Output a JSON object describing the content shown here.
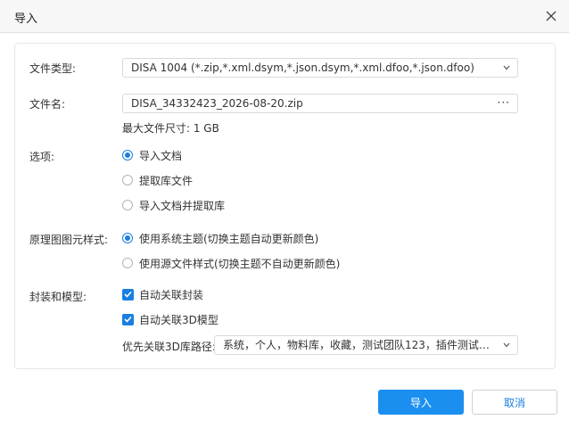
{
  "window": {
    "title": "导入"
  },
  "form": {
    "file_type": {
      "label": "文件类型:",
      "value": "DISA 1004 (*.zip,*.xml.dsym,*.json.dsym,*.xml.dfoo,*.json.dfoo)"
    },
    "file_name": {
      "label": "文件名:",
      "value": "DISA_34332423_2026-08-20.zip",
      "browse": "···"
    },
    "max_size": "最大文件尺寸: 1 GB",
    "options": {
      "label": "选项:",
      "items": [
        {
          "label": "导入文档",
          "selected": true
        },
        {
          "label": "提取库文件",
          "selected": false
        },
        {
          "label": "导入文档并提取库",
          "selected": false
        }
      ]
    },
    "style": {
      "label": "原理图图元样式:",
      "items": [
        {
          "label": "使用系统主题(切换主题自动更新颜色)",
          "selected": true
        },
        {
          "label": "使用源文件样式(切换主题不自动更新颜色)",
          "selected": false
        }
      ]
    },
    "package": {
      "label": "封装和模型:",
      "items": [
        {
          "label": "自动关联封装",
          "checked": true
        },
        {
          "label": "自动关联3D模型",
          "checked": true
        }
      ],
      "path_label": "优先关联3D库路径:",
      "path_value": "系统，个人，物料库，收藏，测试团队123，插件测试，..."
    }
  },
  "buttons": {
    "import": "导入",
    "cancel": "取消"
  },
  "colors": {
    "accent": "#1a8ff0",
    "title_bg": "#f7f7f7"
  }
}
